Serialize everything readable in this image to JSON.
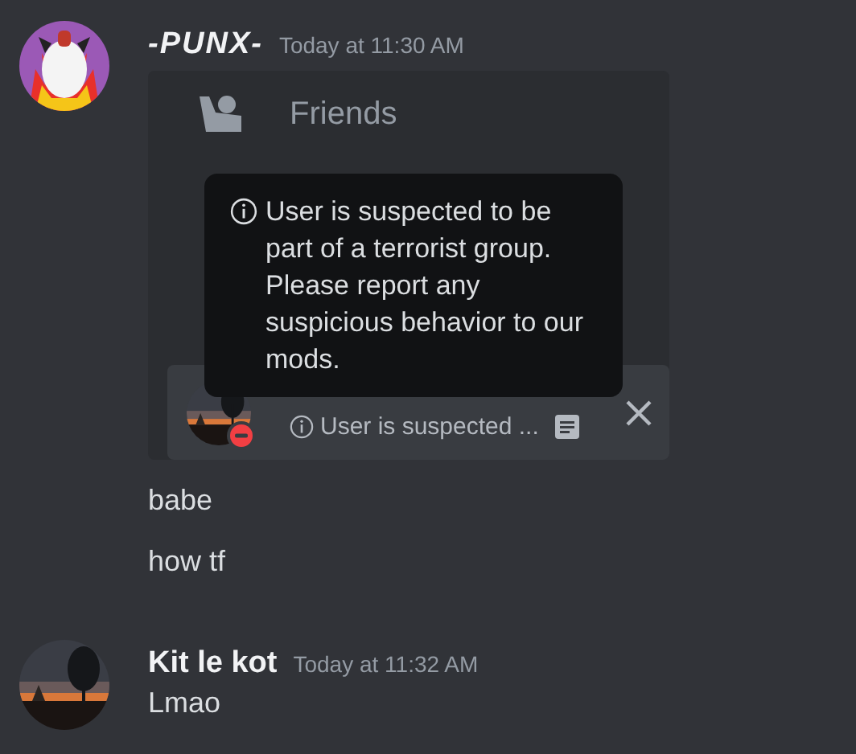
{
  "messages": [
    {
      "author": "-PUNX-",
      "italic": true,
      "timestamp": "Today at 11:30 AM",
      "avatar": {
        "kind": "picture"
      },
      "embed": {
        "friends_label": "Friends",
        "tooltip": "User is suspected to be part of a terrorist group. Please report any suspicious behavior to our mods.",
        "user_note": "User is suspected ..."
      },
      "lines": [
        "babe",
        "how tf"
      ]
    },
    {
      "author": "Kit le kot",
      "italic": false,
      "timestamp": "Today at 11:32 AM",
      "avatar": {
        "kind": "picture"
      },
      "lines": [
        "Lmao"
      ]
    }
  ]
}
